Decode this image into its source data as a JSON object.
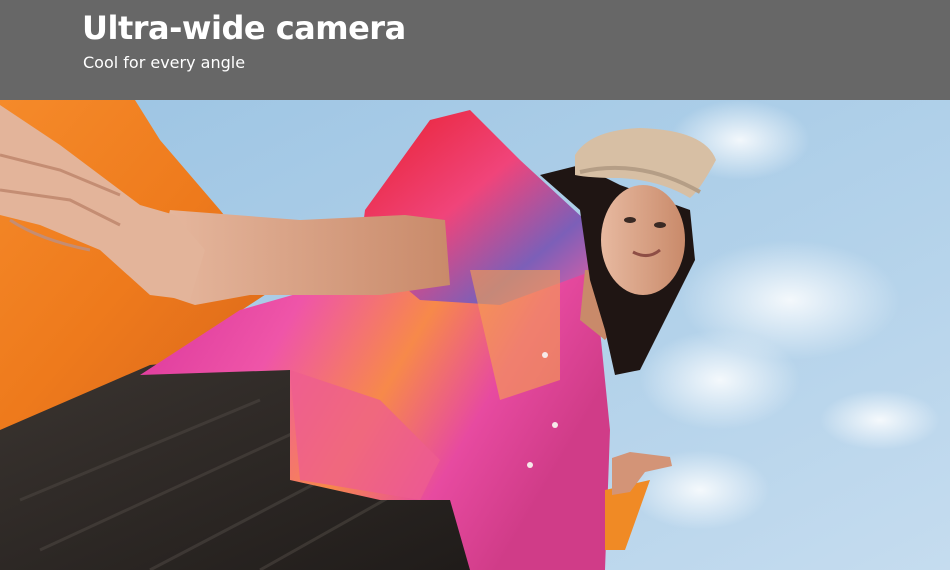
{
  "hero": {
    "title": "Ultra-wide camera",
    "subtitle": "Cool for every angle"
  },
  "photo": {
    "subject": "woman-in-beret-low-angle-portrait",
    "colors": {
      "header_background": "#676767",
      "sky": "#a9cbe6",
      "orange_fabric": "#f07a1e",
      "shirt_pink": "#e8469a",
      "shirt_orange": "#f39a4a",
      "beret": "#d7bfa4",
      "skirt": "#2b2623"
    }
  }
}
